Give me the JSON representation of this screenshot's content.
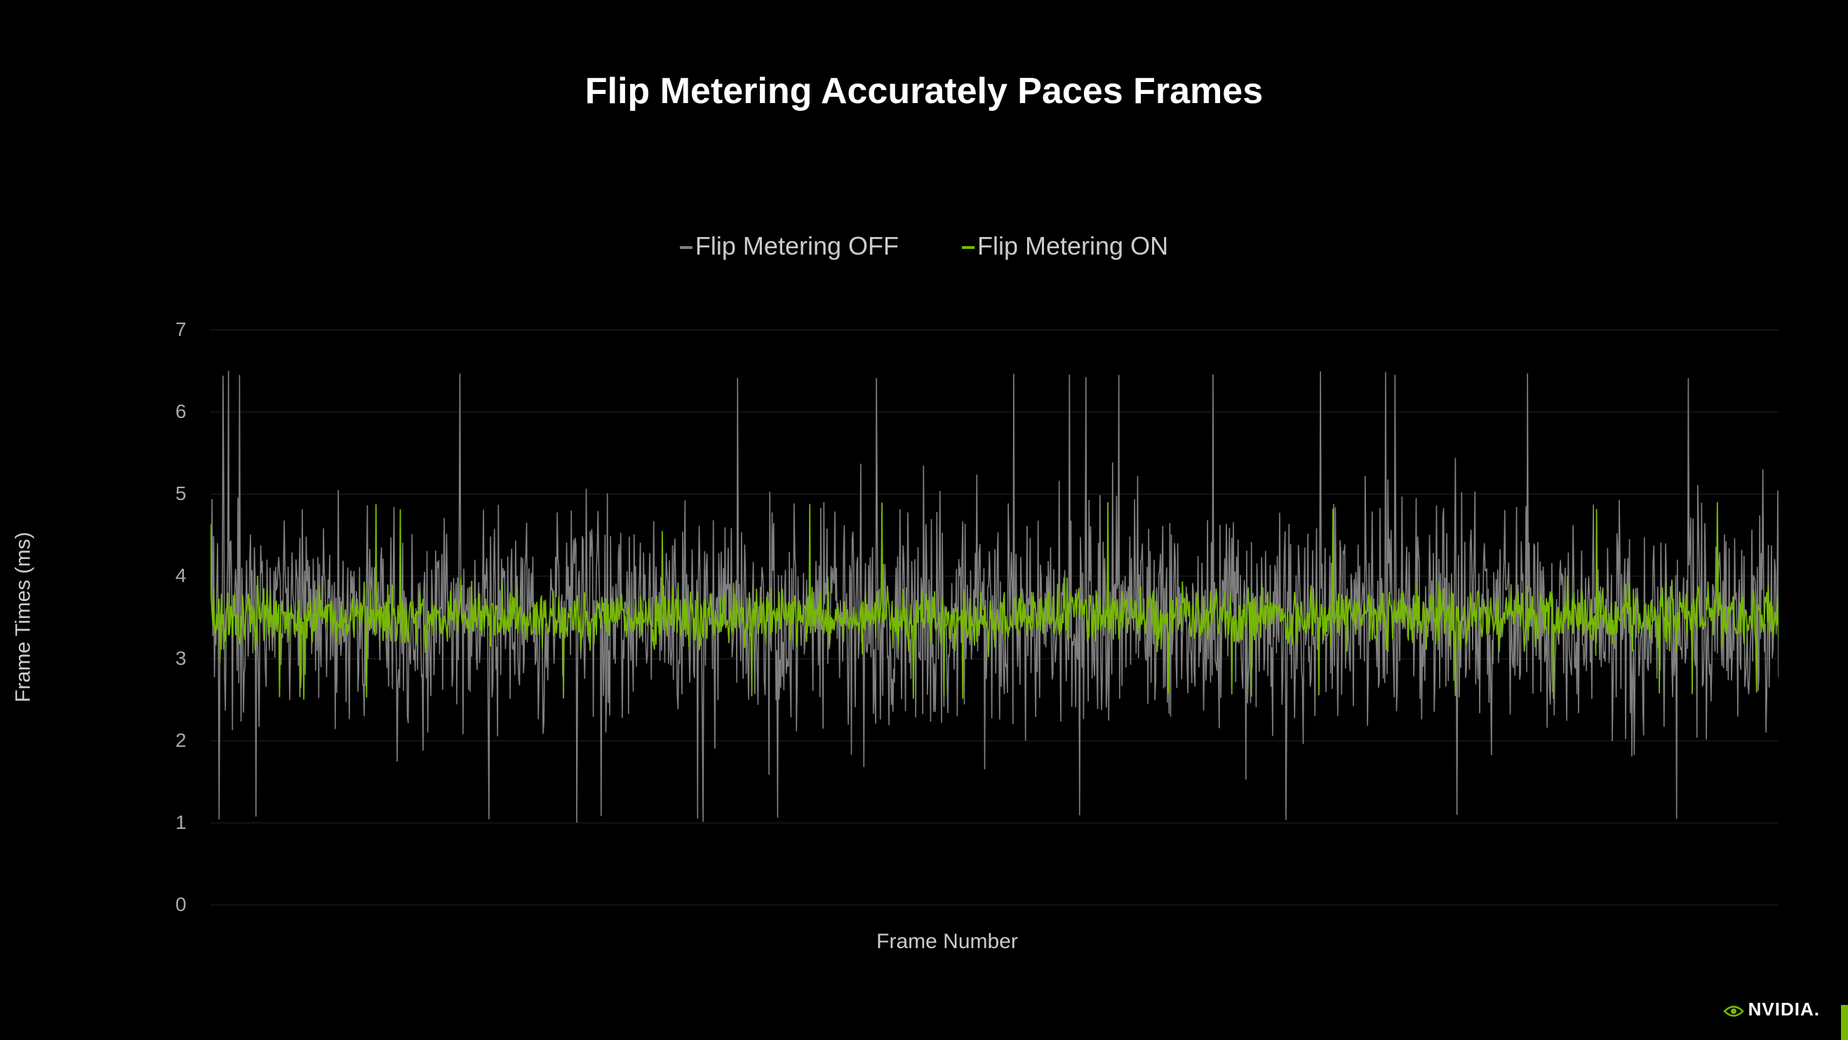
{
  "title": "Flip Metering Accurately Paces Frames",
  "legend": {
    "off": "Flip Metering OFF",
    "on": "Flip Metering ON"
  },
  "xlabel": "Frame Number",
  "ylabel": "Frame Times (ms)",
  "yticks": [
    0,
    1,
    2,
    3,
    4,
    5,
    6,
    7
  ],
  "brand": "NVIDIA.",
  "chart_data": {
    "type": "line",
    "title": "Flip Metering Accurately Paces Frames",
    "xlabel": "Frame Number",
    "ylabel": "Frame Times (ms)",
    "ylim": [
      0,
      7
    ],
    "x_range": [
      0,
      2000
    ],
    "series": [
      {
        "name": "Flip Metering OFF",
        "color": "#808080",
        "description": "Highly variable frame times — noisy signal oscillating roughly between ~1.0 ms and ~6.5 ms, centered around ~3.5 ms, with occasional spikes to ~6.5 ms and dips to ~1.0 ms.",
        "stats": {
          "mean": 3.5,
          "min": 1.0,
          "max": 6.5,
          "stdev": 1.3
        }
      },
      {
        "name": "Flip Metering ON",
        "color": "#76b900",
        "description": "Much tighter frame times — mostly between ~3.0 ms and ~4.2 ms, centered around ~3.5 ms, with rare spikes near ~4.8 ms and dips near ~2.5 ms.",
        "stats": {
          "mean": 3.5,
          "min": 2.5,
          "max": 4.9,
          "stdev": 0.35
        }
      }
    ],
    "note": "Dense time-series of ~2000 frames per series; individual per-frame values are not labeled in the image and are represented here by summary statistics and visually-reconstructed noise."
  }
}
